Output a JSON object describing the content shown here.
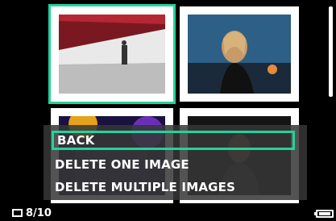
{
  "menu": {
    "items": [
      {
        "label": "BACK",
        "selected": true
      },
      {
        "label": "DELETE ONE IMAGE",
        "selected": false
      },
      {
        "label": "DELETE MULTIPLE IMAGES",
        "selected": false
      }
    ]
  },
  "status": {
    "counter": "8/10",
    "counter_icon": "image-frame-icon",
    "battery_icon": "battery-full-icon"
  },
  "colors": {
    "accent": "#22d39a",
    "background": "#000000",
    "menu_background": "#373737"
  },
  "thumbnails": [
    {
      "subject": "architecture with person walking",
      "selected": true
    },
    {
      "subject": "woman portrait at dusk",
      "selected": false
    },
    {
      "subject": "concert stage lights",
      "selected": false
    },
    {
      "subject": "person in dark",
      "selected": false
    }
  ]
}
